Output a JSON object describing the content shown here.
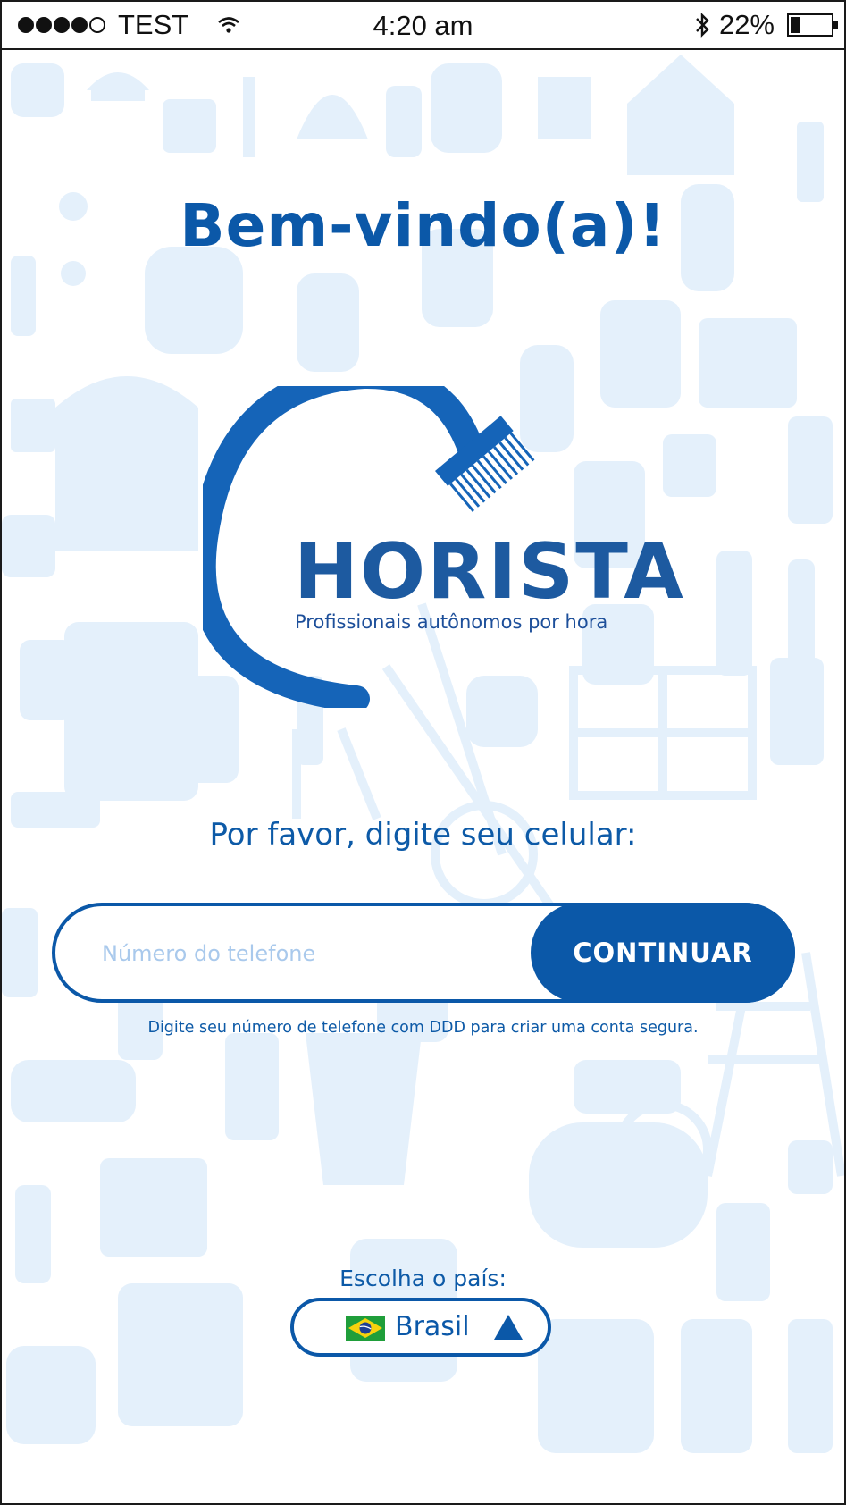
{
  "status_bar": {
    "carrier": "TEST",
    "time": "4:20 am",
    "battery_percent": "22%",
    "battery_level": 0.22,
    "signal_bars_filled": 4,
    "signal_bars_total": 5
  },
  "welcome": {
    "title": "Bem-vindo(a)!"
  },
  "logo": {
    "brand": "HORISTA",
    "tagline": "Profissionais autônomos por hora"
  },
  "phone_form": {
    "prompt": "Por favor, digite seu celular:",
    "placeholder": "Número do telefone",
    "value": "",
    "continue_label": "CONTINUAR",
    "hint": "Digite seu número de telefone com DDD para criar uma conta segura."
  },
  "country": {
    "label": "Escolha o país:",
    "selected": "Brasil",
    "flag_icon": "brazil-flag-icon",
    "arrow_icon": "triangle-up-icon"
  },
  "colors": {
    "primary": "#0b58a8",
    "pattern": "#e4f0fb",
    "logo_dark": "#1d5aa0"
  }
}
